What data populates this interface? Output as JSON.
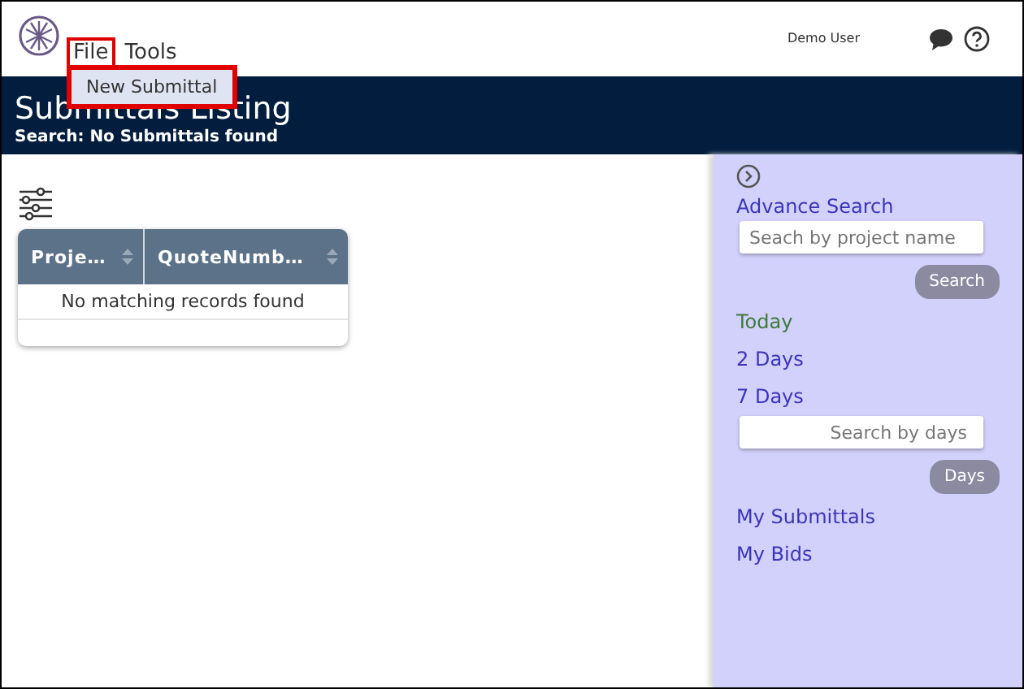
{
  "menu": [
    {
      "label": "File",
      "highlighted": true,
      "expanded": true,
      "items": [
        {
          "label": "New Submittal",
          "highlighted": true
        }
      ]
    },
    {
      "label": "Tools",
      "highlighted": false,
      "expanded": false
    }
  ],
  "user": "Demo User",
  "banner": {
    "title": "Submittals Listing",
    "subtitle": "Search: No Submittals found"
  },
  "table": {
    "columns": [
      "Proje…",
      "QuoteNumb…"
    ],
    "empty_message": "No matching records found"
  },
  "sidebar": {
    "heading": "Advance Search",
    "project_search": {
      "placeholder": "Seach by project name",
      "button": "Search"
    },
    "quick_links": [
      {
        "label": "Today",
        "selected": true
      },
      {
        "label": "2 Days",
        "selected": false
      },
      {
        "label": "7 Days",
        "selected": false
      }
    ],
    "days_search": {
      "placeholder": "Search by days",
      "button": "Days"
    },
    "links": [
      "My Submittals",
      "My Bids"
    ]
  }
}
